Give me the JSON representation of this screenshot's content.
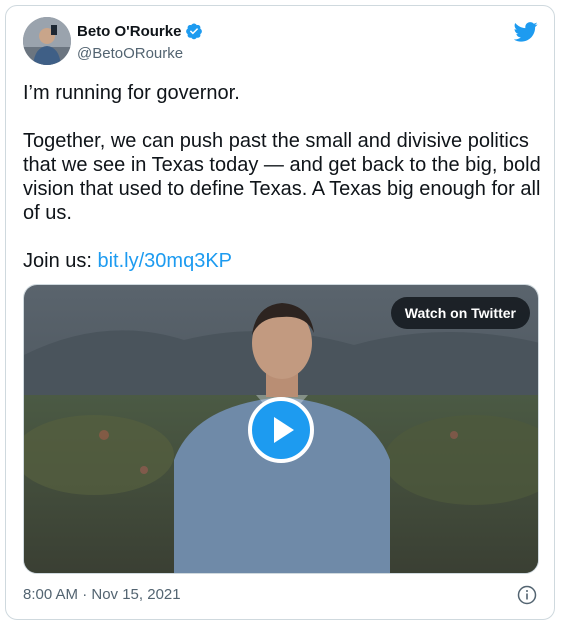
{
  "author": {
    "display_name": "Beto O'Rourke",
    "handle": "@BetoORourke",
    "verified": true
  },
  "tweet": {
    "paragraphs": [
      "I’m running for governor.",
      "Together, we can push past the small and divisive politics that we see in Texas today — and get back to the big, bold vision that used to define Texas. A Texas big enough for all of us."
    ],
    "join_prefix": "Join us: ",
    "link_text": "bit.ly/30mq3KP"
  },
  "media": {
    "watch_label": "Watch on Twitter"
  },
  "footer": {
    "timestamp": "8:00 AM · Nov 15, 2021"
  },
  "colors": {
    "accent": "#1d9bf0",
    "text": "#0f1419",
    "muted": "#536471",
    "border": "#cfd9de"
  },
  "icons": [
    "twitter-bird-icon",
    "verified-badge-icon",
    "play-icon",
    "info-icon"
  ]
}
